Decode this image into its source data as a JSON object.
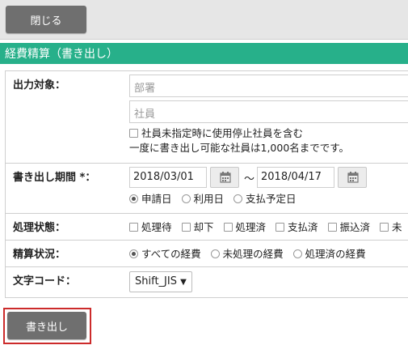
{
  "toolbar": {
    "close_label": "閉じる"
  },
  "page": {
    "title": "経費精算（書き出し）"
  },
  "form": {
    "target": {
      "label": "出力対象：",
      "department_placeholder": "部署",
      "employee_placeholder": "社員",
      "include_suspended_label": "社員未指定時に使用停止社員を含む",
      "note": "一度に書き出し可能な社員は1,000名までです。"
    },
    "period": {
      "label": "書き出し期間 *：",
      "start_date": "2018/03/01",
      "end_date": "2018/04/17",
      "separator": "〜",
      "date_type_options": [
        "申請日",
        "利用日",
        "支払予定日"
      ],
      "date_type_selected": "申請日"
    },
    "status": {
      "label": "処理状態：",
      "options": [
        "処理待",
        "却下",
        "処理済",
        "支払済",
        "振込済",
        "未"
      ]
    },
    "settlement": {
      "label": "精算状況：",
      "options": [
        "すべての経費",
        "未処理の経費",
        "処理済の経費"
      ],
      "selected": "すべての経費"
    },
    "encoding": {
      "label": "文字コード：",
      "selected": "Shift_JIS"
    }
  },
  "actions": {
    "export_label": "書き出し"
  },
  "colors": {
    "header_green": "#27b08a",
    "button_gray": "#6f6f6f",
    "highlight_red": "#cc2b2b"
  },
  "icons": {
    "calendar": "calendar-icon",
    "dropdown": "triangle-down-icon"
  }
}
